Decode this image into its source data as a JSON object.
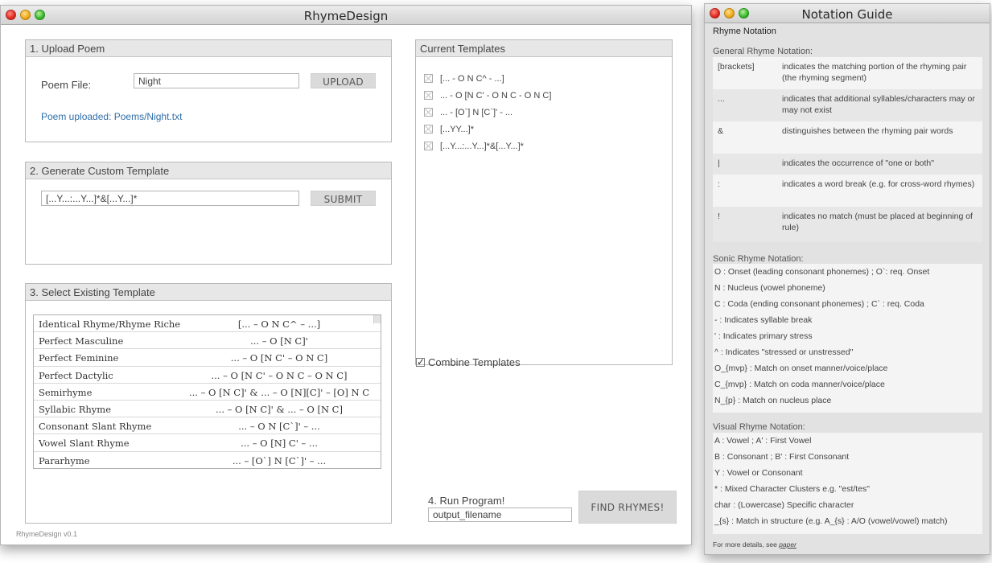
{
  "main_window": {
    "title": "RhymeDesign",
    "version": "RhymeDesign v0.1",
    "upload": {
      "header": "1. Upload Poem",
      "poem_file_label": "Poem File:",
      "poem_file_value": "Night",
      "upload_button": "UPLOAD",
      "status": "Poem uploaded: Poems/Night.txt"
    },
    "custom": {
      "header": "2. Generate Custom Template",
      "template_value": "[...Y...:...Y...]*&[...Y...]*",
      "submit_button": "SUBMIT"
    },
    "existing": {
      "header": "3. Select Existing Template",
      "rows": [
        {
          "name": "Identical Rhyme/Rhyme Riche",
          "pattern": "[... – O N C^ – ...]"
        },
        {
          "name": "Perfect Masculine",
          "pattern": "... – O [N C]'"
        },
        {
          "name": "Perfect Feminine",
          "pattern": "... – O [N C' – O N C]"
        },
        {
          "name": "Perfect Dactylic",
          "pattern": "... – O [N C' – O N C – O N C]"
        },
        {
          "name": "Semirhyme",
          "pattern": "... – O [N C]' & ... – O [N][C]' – [O] N C"
        },
        {
          "name": "Syllabic Rhyme",
          "pattern": "... – O [N C]' & ... – O [N C]"
        },
        {
          "name": "Consonant Slant Rhyme",
          "pattern": "... – O N [C`]' – ..."
        },
        {
          "name": "Vowel Slant Rhyme",
          "pattern": "... – O [N] C' – ..."
        },
        {
          "name": "Pararhyme",
          "pattern": "... – [O`] N [C`]' – ..."
        }
      ]
    },
    "current": {
      "header": "Current Templates",
      "items": [
        "[... - O N C^ - ...]",
        "... - O [N C' - O N C - O N C]",
        "... - [O`] N [C`]' - ...",
        "[...YY...]*",
        "[...Y...:...Y...]*&[...Y...]*"
      ]
    },
    "combine_label": "Combine Templates",
    "run": {
      "label": "4. Run Program!",
      "output_value": "output_filename",
      "find_button": "FIND RHYMES!"
    }
  },
  "guide_window": {
    "title": "Notation Guide",
    "heading": "Rhyme Notation",
    "general": {
      "label": "General Rhyme Notation:",
      "rows": [
        {
          "symbol": "[brackets]",
          "desc": "indicates the matching portion of the rhyming pair (the rhyming segment)"
        },
        {
          "symbol": "...",
          "desc": "indicates that additional syllables/characters may or may not exist"
        },
        {
          "symbol": "&",
          "desc": "distinguishes between the rhyming pair words"
        },
        {
          "symbol": "|",
          "desc": "indicates the occurrence of \"one or both\""
        },
        {
          "symbol": ":",
          "desc": "indicates a word break (e.g. for cross-word rhymes)"
        },
        {
          "symbol": "!",
          "desc": "indicates no match (must be placed at beginning of rule)"
        }
      ]
    },
    "sonic": {
      "label": "Sonic Rhyme Notation:",
      "lines": [
        "O : Onset (leading consonant phonemes) ; O`: req. Onset",
        "N : Nucleus (vowel phoneme)",
        "C : Coda (ending consonant phonemes) ; C` : req. Coda",
        " - : Indicates syllable break",
        " ' : Indicates primary stress",
        " ^ : Indicates \"stressed or unstressed\"",
        "O_{mvp} : Match on onset manner/voice/place",
        "C_{mvp} : Match on coda manner/voice/place",
        "N_{p} : Match on nucleus place"
      ]
    },
    "visual": {
      "label": "Visual Rhyme Notation:",
      "lines": [
        "A : Vowel ; A' : First Vowel",
        "B : Consonant ; B' : First Consonant",
        "Y : Vowel or Consonant",
        "* : Mixed Character Clusters e.g. \"est/tes\"",
        " char : (Lowercase) Specific character",
        "_{s} : Match in structure (e.g. A_{s} : A/O (vowel/vowel) match)"
      ]
    },
    "footer_text": "For more details, see ",
    "footer_link": "paper"
  }
}
